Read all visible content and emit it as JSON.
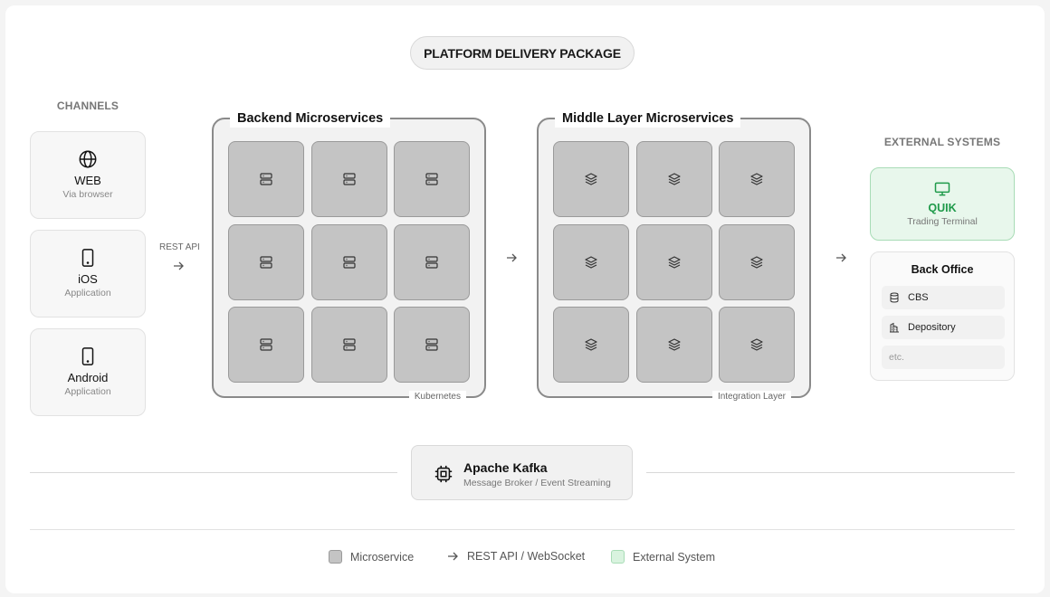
{
  "title": "PLATFORM DELIVERY PACKAGE",
  "channels": {
    "heading": "CHANNELS",
    "items": [
      {
        "title": "WEB",
        "subtitle": "Via browser",
        "icon": "globe-icon"
      },
      {
        "title": "iOS",
        "subtitle": "Application",
        "icon": "phone-icon"
      },
      {
        "title": "Android",
        "subtitle": "Application",
        "icon": "phone-icon"
      }
    ],
    "connector_label": "REST API"
  },
  "backend": {
    "title": "Backend Microservices",
    "footer": "Kubernetes",
    "tile_icon": "server-icon",
    "tile_count": 9
  },
  "middle": {
    "title": "Middle Layer Microservices",
    "footer": "Integration Layer",
    "tile_icon": "layers-icon",
    "tile_count": 9
  },
  "external": {
    "heading": "EXTERNAL SYSTEMS",
    "quik": {
      "title": "QUIK",
      "subtitle": "Trading Terminal",
      "icon": "monitor-icon",
      "color": "#1f9a4a"
    },
    "back_office": {
      "title": "Back Office",
      "items": [
        {
          "label": "CBS",
          "icon": "database-icon"
        },
        {
          "label": "Depository",
          "icon": "building-icon"
        },
        {
          "label": "etc.",
          "icon": ""
        }
      ]
    }
  },
  "kafka": {
    "title": "Apache Kafka",
    "subtitle": "Message Broker / Event Streaming",
    "icon": "cpu-icon"
  },
  "legend": [
    {
      "label": "Microservice",
      "swatch": "#c4c4c4"
    },
    {
      "label": "REST API / WebSocket",
      "swatch": "arrow"
    },
    {
      "label": "External System",
      "swatch": "#d9f3df"
    }
  ]
}
